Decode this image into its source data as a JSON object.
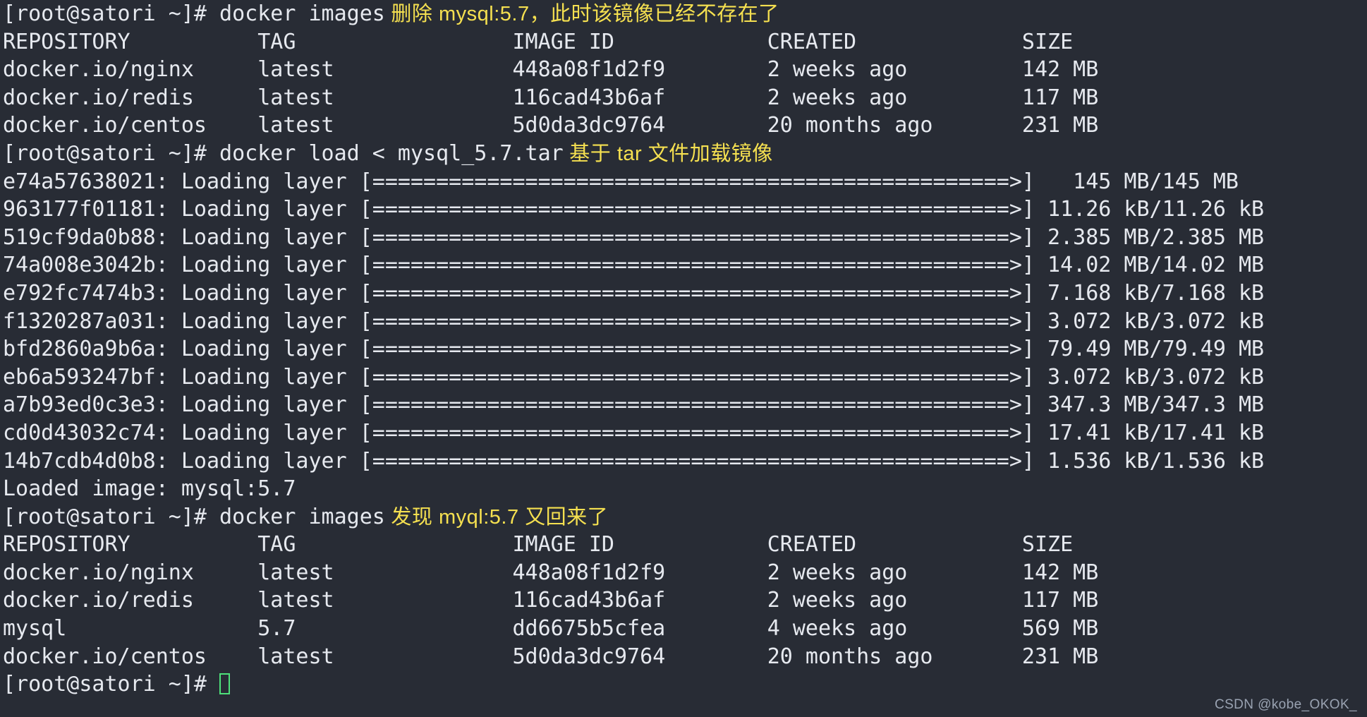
{
  "terminal": {
    "title": "root@satori terminal",
    "colors": {
      "background": "#282c35",
      "foreground": "#e6e9ef",
      "annotation": "#f5e050",
      "cursor": "#4ee07a",
      "watermark": "#9aa3b2"
    },
    "prompt": "[root@satori ~]# ",
    "watermark": "CSDN @kobe_OKOK_",
    "lines": [
      {
        "kind": "command",
        "prompt": "[root@satori ~]# ",
        "command": "docker images",
        "note": " 删除 mysql:5.7，此时该镜像已经不存在了"
      },
      {
        "kind": "output",
        "text": "REPOSITORY          TAG                 IMAGE ID            CREATED             SIZE"
      },
      {
        "kind": "output",
        "text": "docker.io/nginx     latest              448a08f1d2f9        2 weeks ago         142 MB"
      },
      {
        "kind": "output",
        "text": "docker.io/redis     latest              116cad43b6af        2 weeks ago         117 MB"
      },
      {
        "kind": "output",
        "text": "docker.io/centos    latest              5d0da3dc9764        20 months ago       231 MB"
      },
      {
        "kind": "command",
        "prompt": "[root@satori ~]# ",
        "command": "docker load < mysql_5.7.tar",
        "note": " 基于 tar 文件加载镜像"
      },
      {
        "kind": "output",
        "text": "e74a57638021: Loading layer [==================================================>]   145 MB/145 MB"
      },
      {
        "kind": "output",
        "text": "963177f01181: Loading layer [==================================================>] 11.26 kB/11.26 kB"
      },
      {
        "kind": "output",
        "text": "519cf9da0b88: Loading layer [==================================================>] 2.385 MB/2.385 MB"
      },
      {
        "kind": "output",
        "text": "74a008e3042b: Loading layer [==================================================>] 14.02 MB/14.02 MB"
      },
      {
        "kind": "output",
        "text": "e792fc7474b3: Loading layer [==================================================>] 7.168 kB/7.168 kB"
      },
      {
        "kind": "output",
        "text": "f1320287a031: Loading layer [==================================================>] 3.072 kB/3.072 kB"
      },
      {
        "kind": "output",
        "text": "bfd2860a9b6a: Loading layer [==================================================>] 79.49 MB/79.49 MB"
      },
      {
        "kind": "output",
        "text": "eb6a593247bf: Loading layer [==================================================>] 3.072 kB/3.072 kB"
      },
      {
        "kind": "output",
        "text": "a7b93ed0c3e3: Loading layer [==================================================>] 347.3 MB/347.3 MB"
      },
      {
        "kind": "output",
        "text": "cd0d43032c74: Loading layer [==================================================>] 17.41 kB/17.41 kB"
      },
      {
        "kind": "output",
        "text": "14b7cdb4d0b8: Loading layer [==================================================>] 1.536 kB/1.536 kB"
      },
      {
        "kind": "output",
        "text": "Loaded image: mysql:5.7"
      },
      {
        "kind": "command",
        "prompt": "[root@satori ~]# ",
        "command": "docker images",
        "note": " 发现 myql:5.7 又回来了"
      },
      {
        "kind": "output",
        "text": "REPOSITORY          TAG                 IMAGE ID            CREATED             SIZE"
      },
      {
        "kind": "output",
        "text": "docker.io/nginx     latest              448a08f1d2f9        2 weeks ago         142 MB"
      },
      {
        "kind": "output",
        "text": "docker.io/redis     latest              116cad43b6af        2 weeks ago         117 MB"
      },
      {
        "kind": "output",
        "text": "mysql               5.7                 dd6675b5cfea        4 weeks ago         569 MB"
      },
      {
        "kind": "output",
        "text": "docker.io/centos    latest              5d0da3dc9764        20 months ago       231 MB"
      },
      {
        "kind": "prompt",
        "prompt": "[root@satori ~]# ",
        "cursor": true
      }
    ],
    "tables": [
      {
        "name": "docker-images-before",
        "headers": [
          "REPOSITORY",
          "TAG",
          "IMAGE ID",
          "CREATED",
          "SIZE"
        ],
        "rows": [
          [
            "docker.io/nginx",
            "latest",
            "448a08f1d2f9",
            "2 weeks ago",
            "142 MB"
          ],
          [
            "docker.io/redis",
            "latest",
            "116cad43b6af",
            "2 weeks ago",
            "117 MB"
          ],
          [
            "docker.io/centos",
            "latest",
            "5d0da3dc9764",
            "20 months ago",
            "231 MB"
          ]
        ]
      },
      {
        "name": "docker-images-after",
        "headers": [
          "REPOSITORY",
          "TAG",
          "IMAGE ID",
          "CREATED",
          "SIZE"
        ],
        "rows": [
          [
            "docker.io/nginx",
            "latest",
            "448a08f1d2f9",
            "2 weeks ago",
            "142 MB"
          ],
          [
            "docker.io/redis",
            "latest",
            "116cad43b6af",
            "2 weeks ago",
            "117 MB"
          ],
          [
            "mysql",
            "5.7",
            "dd6675b5cfea",
            "4 weeks ago",
            "569 MB"
          ],
          [
            "docker.io/centos",
            "latest",
            "5d0da3dc9764",
            "20 months ago",
            "231 MB"
          ]
        ]
      }
    ],
    "loading_layers": [
      {
        "id": "e74a57638021",
        "label": "Loading layer",
        "progress": 100,
        "size": "145 MB/145 MB"
      },
      {
        "id": "963177f01181",
        "label": "Loading layer",
        "progress": 100,
        "size": "11.26 kB/11.26 kB"
      },
      {
        "id": "519cf9da0b88",
        "label": "Loading layer",
        "progress": 100,
        "size": "2.385 MB/2.385 MB"
      },
      {
        "id": "74a008e3042b",
        "label": "Loading layer",
        "progress": 100,
        "size": "14.02 MB/14.02 MB"
      },
      {
        "id": "e792fc7474b3",
        "label": "Loading layer",
        "progress": 100,
        "size": "7.168 kB/7.168 kB"
      },
      {
        "id": "f1320287a031",
        "label": "Loading layer",
        "progress": 100,
        "size": "3.072 kB/3.072 kB"
      },
      {
        "id": "bfd2860a9b6a",
        "label": "Loading layer",
        "progress": 100,
        "size": "79.49 MB/79.49 MB"
      },
      {
        "id": "eb6a593247bf",
        "label": "Loading layer",
        "progress": 100,
        "size": "3.072 kB/3.072 kB"
      },
      {
        "id": "a7b93ed0c3e3",
        "label": "Loading layer",
        "progress": 100,
        "size": "347.3 MB/347.3 MB"
      },
      {
        "id": "cd0d43032c74",
        "label": "Loading layer",
        "progress": 100,
        "size": "17.41 kB/17.41 kB"
      },
      {
        "id": "14b7cdb4d0b8",
        "label": "Loading layer",
        "progress": 100,
        "size": "1.536 kB/1.536 kB"
      }
    ]
  }
}
